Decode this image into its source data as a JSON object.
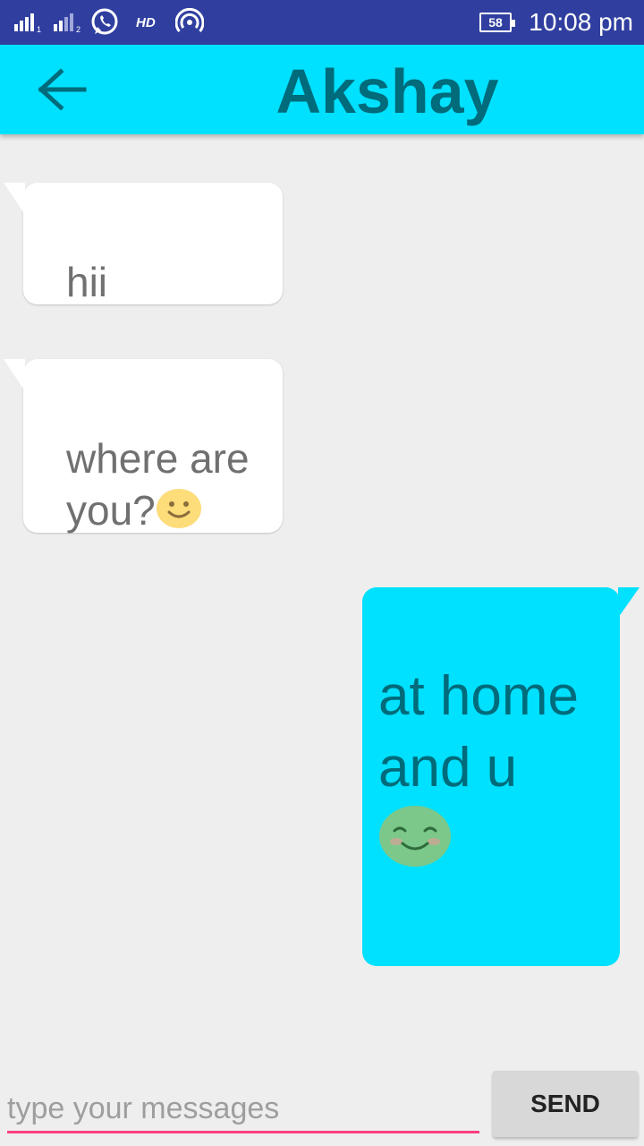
{
  "status_bar": {
    "time": "10:08 pm",
    "battery_level": "58",
    "network_label": "HD",
    "icons": [
      "signal-sim1-icon",
      "signal-sim2-icon",
      "whatsapp-icon",
      "hd-icon",
      "hotspot-icon",
      "battery-icon"
    ]
  },
  "app_bar": {
    "title": "Akshay",
    "back_icon": "arrow-back-icon",
    "background_color": "#00e0ff"
  },
  "messages": [
    {
      "direction": "incoming",
      "text": "hii"
    },
    {
      "direction": "incoming",
      "text": "where are you?",
      "emoji": "slightly-smiling-face-icon"
    },
    {
      "direction": "outgoing",
      "text": "at home and u",
      "emoji": "smiling-face-with-smiling-eyes-icon"
    }
  ],
  "composer": {
    "placeholder": "type your messages",
    "value": "",
    "send_label": "SEND",
    "accent_color": "#ff4081"
  },
  "colors": {
    "status_bar": "#303f9f",
    "outgoing_bubble": "#00e0ff",
    "incoming_bubble": "#ffffff",
    "background": "#eeeeee"
  }
}
